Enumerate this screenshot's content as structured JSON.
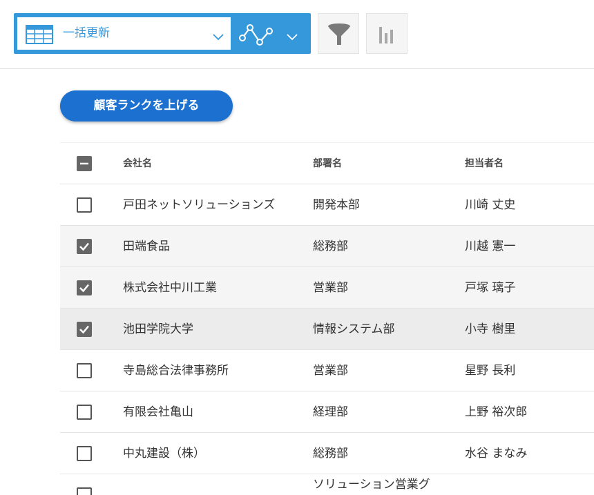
{
  "toolbar": {
    "view_label": "一括更新",
    "view_icon": "table-icon",
    "graph_icon": "line-graph-icon",
    "filter_icon": "funnel-icon",
    "chart_icon": "bar-chart-icon"
  },
  "action": {
    "rank_up_label": "顧客ランクを上げる"
  },
  "table": {
    "headers": {
      "company": "会社名",
      "department": "部署名",
      "person": "担当者名"
    },
    "rows": [
      {
        "company": "戸田ネットソリューションズ",
        "department": "開発本部",
        "person": "川崎 丈史",
        "checked": false
      },
      {
        "company": "田端食品",
        "department": "総務部",
        "person": "川越 憲一",
        "checked": true
      },
      {
        "company": "株式会社中川工業",
        "department": "営業部",
        "person": "戸塚 璃子",
        "checked": true
      },
      {
        "company": "池田学院大学",
        "department": "情報システム部",
        "person": "小寺 樹里",
        "checked": true
      },
      {
        "company": "寺島総合法律事務所",
        "department": "営業部",
        "person": "星野 長利",
        "checked": false
      },
      {
        "company": "有限会社亀山",
        "department": "経理部",
        "person": "上野 裕次郎",
        "checked": false
      },
      {
        "company": "中丸建設（株）",
        "department": "総務部",
        "person": "水谷 まなみ",
        "checked": false
      }
    ],
    "partial_row": {
      "department": "ソリューション営業グ"
    }
  },
  "colors": {
    "accent": "#3498db",
    "button": "#1b70d0",
    "checkbox": "#666666"
  }
}
